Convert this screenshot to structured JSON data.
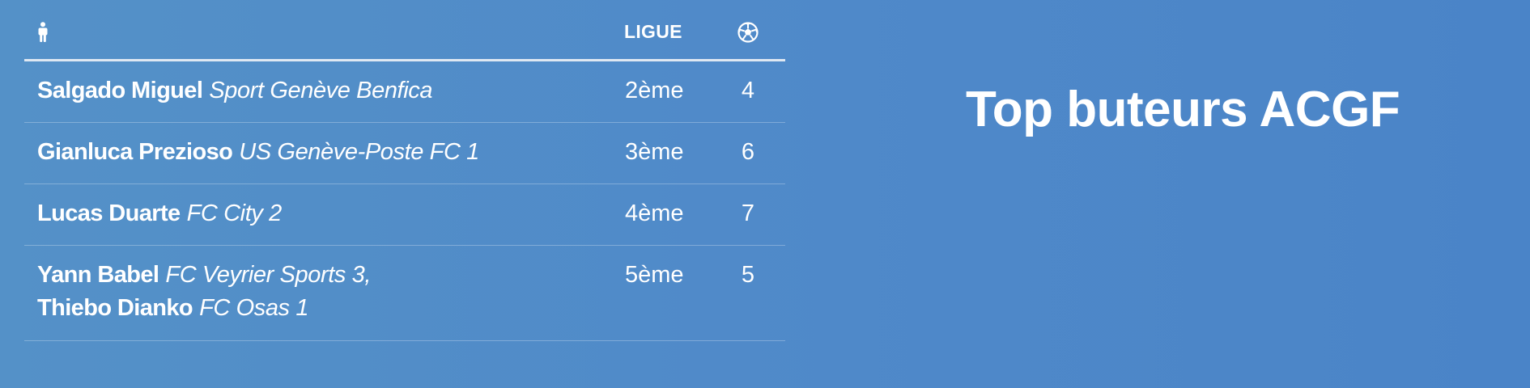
{
  "header": {
    "player_icon": "person-icon",
    "league_label": "LIGUE",
    "goals_icon": "soccer-ball-icon"
  },
  "rows": [
    {
      "players": [
        {
          "name": "Salgado Miguel",
          "team": "Sport Genève Benfica"
        }
      ],
      "league": "2ème",
      "goals": "4"
    },
    {
      "players": [
        {
          "name": "Gianluca Prezioso",
          "team": "US Genève-Poste FC 1"
        }
      ],
      "league": "3ème",
      "goals": "6"
    },
    {
      "players": [
        {
          "name": "Lucas Duarte",
          "team": "FC City 2"
        }
      ],
      "league": "4ème",
      "goals": "7"
    },
    {
      "players": [
        {
          "name": "Yann Babel",
          "team": "FC Veyrier Sports 3,"
        },
        {
          "name": "Thiebo Dianko",
          "team": "FC Osas 1"
        }
      ],
      "league": "5ème",
      "goals": "5"
    }
  ],
  "title": "Top buteurs ACGF",
  "colors": {
    "background_left": "#5491c8",
    "background_right": "#4a84c8",
    "text": "#ffffff",
    "header_rule": "#dfe8f2"
  }
}
